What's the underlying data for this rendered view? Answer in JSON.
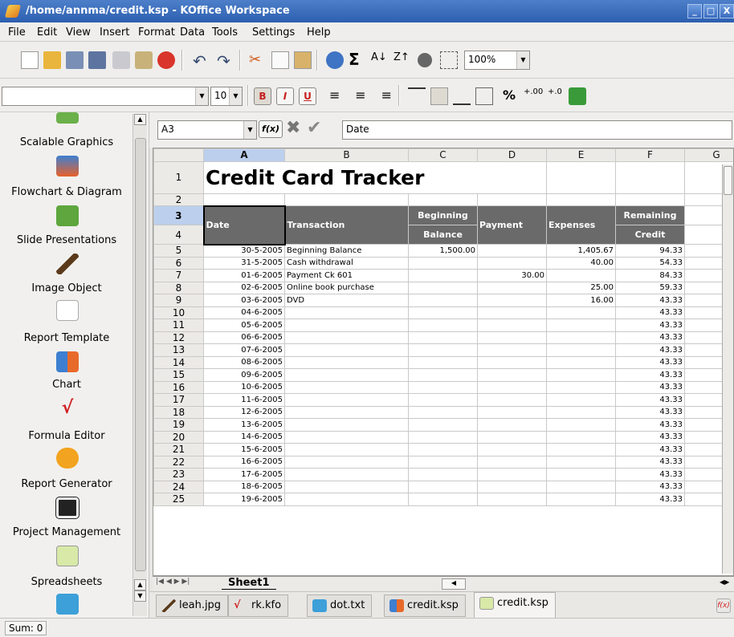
{
  "window": {
    "title": "/home/annma/credit.ksp - KOffice Workspace",
    "min": "_",
    "max": "□",
    "close": "X"
  },
  "menu": [
    "File",
    "Edit",
    "View",
    "Insert",
    "Format",
    "Data",
    "Tools",
    "Settings",
    "Help"
  ],
  "toolbar": {
    "zoom": "100%",
    "font_name": "",
    "font_size": "10",
    "bold": "B",
    "italic": "I",
    "underline": "U",
    "percent": "%"
  },
  "formula": {
    "cell_ref": "A3",
    "fx": "f(x)",
    "content": "Date"
  },
  "sidebar": {
    "items": [
      "Scalable Graphics",
      "Flowchart & Diagram",
      "Slide Presentations",
      "Image Object",
      "Report Template",
      "Chart",
      "Formula Editor",
      "Report Generator",
      "Project Management",
      "Spreadsheets"
    ]
  },
  "sheet": {
    "columns": [
      "A",
      "B",
      "C",
      "D",
      "E",
      "F",
      "G"
    ],
    "title": "Credit Card Tracker",
    "headers": {
      "date": "Date",
      "transaction": "Transaction",
      "begin1": "Beginning",
      "begin2": "Balance",
      "payment": "Payment",
      "expenses": "Expenses",
      "remain1": "Remaining",
      "remain2": "Credit"
    },
    "rows": [
      {
        "n": "5",
        "date": "30-5-2005",
        "tx": "Beginning Balance",
        "bal": "1,500.00",
        "pay": "",
        "exp": "1,405.67",
        "rem": "94.33"
      },
      {
        "n": "6",
        "date": "31-5-2005",
        "tx": "Cash withdrawal",
        "bal": "",
        "pay": "",
        "exp": "40.00",
        "rem": "54.33"
      },
      {
        "n": "7",
        "date": "01-6-2005",
        "tx": "Payment Ck 601",
        "bal": "",
        "pay": "30.00",
        "exp": "",
        "rem": "84.33"
      },
      {
        "n": "8",
        "date": "02-6-2005",
        "tx": "Online book purchase",
        "bal": "",
        "pay": "",
        "exp": "25.00",
        "rem": "59.33"
      },
      {
        "n": "9",
        "date": "03-6-2005",
        "tx": "DVD",
        "bal": "",
        "pay": "",
        "exp": "16.00",
        "rem": "43.33"
      },
      {
        "n": "10",
        "date": "04-6-2005",
        "tx": "",
        "bal": "",
        "pay": "",
        "exp": "",
        "rem": "43.33"
      },
      {
        "n": "11",
        "date": "05-6-2005",
        "tx": "",
        "bal": "",
        "pay": "",
        "exp": "",
        "rem": "43.33"
      },
      {
        "n": "12",
        "date": "06-6-2005",
        "tx": "",
        "bal": "",
        "pay": "",
        "exp": "",
        "rem": "43.33"
      },
      {
        "n": "13",
        "date": "07-6-2005",
        "tx": "",
        "bal": "",
        "pay": "",
        "exp": "",
        "rem": "43.33"
      },
      {
        "n": "14",
        "date": "08-6-2005",
        "tx": "",
        "bal": "",
        "pay": "",
        "exp": "",
        "rem": "43.33"
      },
      {
        "n": "15",
        "date": "09-6-2005",
        "tx": "",
        "bal": "",
        "pay": "",
        "exp": "",
        "rem": "43.33"
      },
      {
        "n": "16",
        "date": "10-6-2005",
        "tx": "",
        "bal": "",
        "pay": "",
        "exp": "",
        "rem": "43.33"
      },
      {
        "n": "17",
        "date": "11-6-2005",
        "tx": "",
        "bal": "",
        "pay": "",
        "exp": "",
        "rem": "43.33"
      },
      {
        "n": "18",
        "date": "12-6-2005",
        "tx": "",
        "bal": "",
        "pay": "",
        "exp": "",
        "rem": "43.33"
      },
      {
        "n": "19",
        "date": "13-6-2005",
        "tx": "",
        "bal": "",
        "pay": "",
        "exp": "",
        "rem": "43.33"
      },
      {
        "n": "20",
        "date": "14-6-2005",
        "tx": "",
        "bal": "",
        "pay": "",
        "exp": "",
        "rem": "43.33"
      },
      {
        "n": "21",
        "date": "15-6-2005",
        "tx": "",
        "bal": "",
        "pay": "",
        "exp": "",
        "rem": "43.33"
      },
      {
        "n": "22",
        "date": "16-6-2005",
        "tx": "",
        "bal": "",
        "pay": "",
        "exp": "",
        "rem": "43.33"
      },
      {
        "n": "23",
        "date": "17-6-2005",
        "tx": "",
        "bal": "",
        "pay": "",
        "exp": "",
        "rem": "43.33"
      },
      {
        "n": "24",
        "date": "18-6-2005",
        "tx": "",
        "bal": "",
        "pay": "",
        "exp": "",
        "rem": "43.33"
      },
      {
        "n": "25",
        "date": "19-6-2005",
        "tx": "",
        "bal": "",
        "pay": "",
        "exp": "",
        "rem": "43.33"
      }
    ]
  },
  "sheet_tab": "Sheet1",
  "doc_tabs": [
    "leah.jpg",
    "rk.kfo",
    "dot.txt",
    "credit.ksp",
    "credit.ksp"
  ],
  "status": "Sum: 0"
}
